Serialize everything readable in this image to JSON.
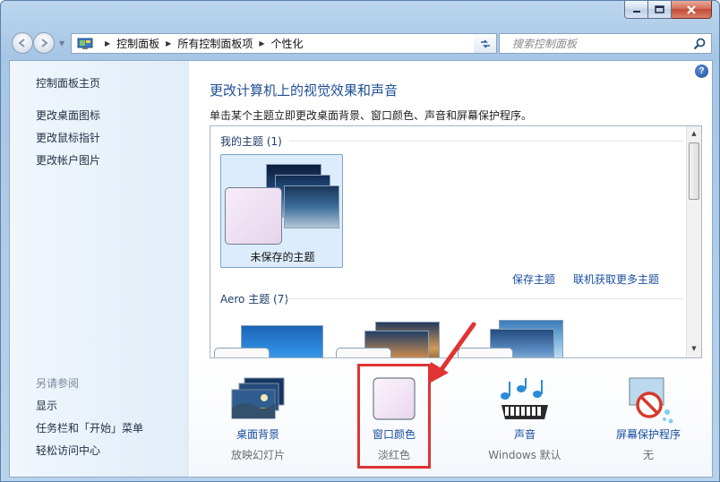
{
  "breadcrumb": [
    "控制面板",
    "所有控制面板项",
    "个性化"
  ],
  "search": {
    "placeholder": "搜索控制面板"
  },
  "help_glyph": "?",
  "sidebar": {
    "home": "控制面板主页",
    "links": [
      "更改桌面图标",
      "更改鼠标指针",
      "更改帐户图片"
    ],
    "see_also": "另请参阅",
    "see_also_links": [
      "显示",
      "任务栏和「开始」菜单",
      "轻松访问中心"
    ]
  },
  "main": {
    "title": "更改计算机上的视觉效果和声音",
    "description": "单击某个主题立即更改桌面背景、窗口颜色、声音和屏幕保护程序。"
  },
  "themes": {
    "my_group": "我的主题 (1)",
    "unsaved_label": "未保存的主题",
    "save_link": "保存主题",
    "online_link": "联机获取更多主题",
    "aero_group": "Aero 主题 (7)"
  },
  "bottom_items": [
    {
      "name": "桌面背景",
      "value": "放映幻灯片"
    },
    {
      "name": "窗口颜色",
      "value": "淡红色"
    },
    {
      "name": "声音",
      "value": "Windows 默认"
    },
    {
      "name": "屏幕保护程序",
      "value": "无"
    }
  ],
  "colors": {
    "link": "#1a4fa0",
    "title": "#1f4e96",
    "highlight": "#e03333",
    "window_color_swatch": "#f3e4f4"
  }
}
